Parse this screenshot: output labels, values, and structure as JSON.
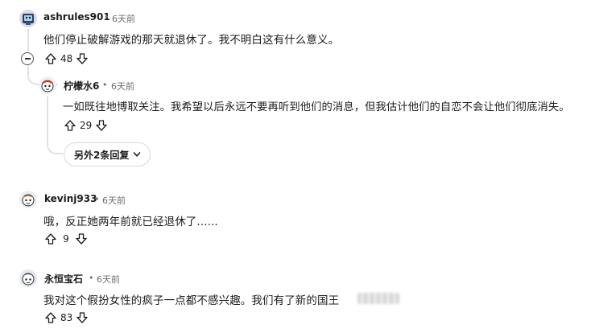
{
  "comments": [
    {
      "author": "ashrules901",
      "time": "6天前",
      "text": "他们停止破解游戏的那天就退休了。我不明白这有什么意义。",
      "score": "48"
    },
    {
      "author": "柠檬水6",
      "time": "6天前",
      "text": "一如既往地博取关注。我希望以后永远不要再听到他们的消息，但我估计他们的自恋不会让他们彻底消失。",
      "score": "29"
    },
    {
      "author": "kevinj933",
      "time": "6天前",
      "text": "哦，反正她两年前就已经退休了......",
      "score": "9"
    },
    {
      "author": "永恒宝石",
      "time": "6天前",
      "text": "我对这个假扮女性的疯子一点都不感兴趣。我们有了新的国王",
      "score": "83"
    }
  ],
  "separator": "•",
  "more_replies_label": "另外2条回复",
  "icons": {
    "upvote": "arrow-up-outline",
    "downvote": "arrow-down-outline",
    "collapse": "circle-minus",
    "expand": "chevron-down"
  }
}
